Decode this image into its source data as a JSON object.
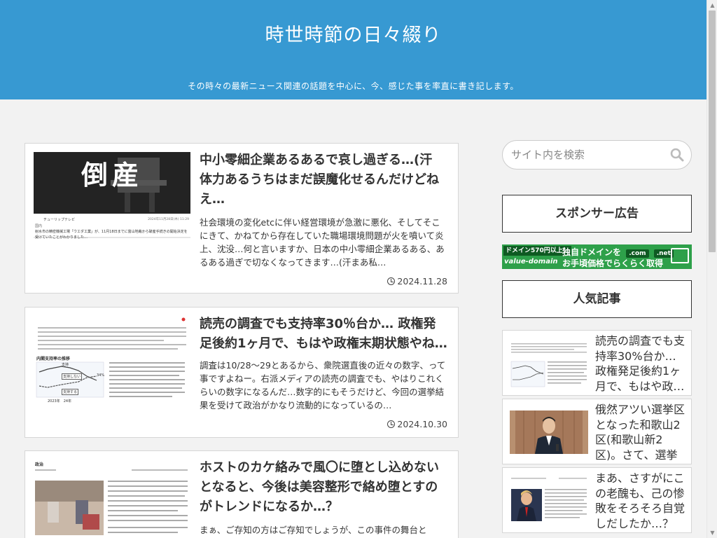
{
  "site": {
    "title": "時世時節の日々綴り",
    "description": "その時々の最新ニュース関連の話題を中心に、今、感じた事を率直に書き記します。"
  },
  "articles": [
    {
      "title": "中小零細企業あるあるで哀し過ぎる…(汗 体力あるうちはまだ誤魔化せるんだけどね え…",
      "excerpt": "社会環境の変化etcに伴い経営環境が急激に悪化、そしてそこにきて、かねてから存在していた職場環境問題が火を噴いて炎上、沈没…何と言いますか、日本の中小零細企業あるある、あるある過ぎで切なくなってきます…(汗まあ私…",
      "date": "2024.11.28",
      "thumb": {
        "headline": "倒産",
        "source": "チューリップテレビ",
        "stamp": "2024年11月28日(木) 11:29",
        "category": "国内",
        "caption": "射水市の精密機械工場「ウエダ工業」が、11月18日までに富山地裁から破産手続きの開始決定を受けていたことがわかりました…"
      }
    },
    {
      "title": "読売の調査でも支持率30％台か… 政権発足後約1ヶ月で、もはや政権末期状態やね…(汗",
      "excerpt": "調査は10/28～29とあるから、衆院選直後の近々の数字、って事ですよねー。右派メディアの読売の調査でも、やはりこれくらいの数字になるんだ…数字的にもそうだけど、今回の選挙結果を受けて政治がかなり流動的になっているの…",
      "date": "2024.10.30",
      "thumb": {
        "heading": "内閣支持率の推移",
        "labels": [
          "支持",
          "支持しない",
          "支持する"
        ],
        "percent": "34%",
        "years": "2023年　24年"
      }
    },
    {
      "title": "ホストのカケ絡みで風〇に堕とし込めないとなると、今後は美容整形で絡め堕とすのがトレンドになるか…？",
      "excerpt": "まぁ、ご存知の方はご存知でしょうが、この事件の舞台と",
      "thumb": {
        "category": "政治"
      }
    }
  ],
  "sidebar": {
    "search_placeholder": "サイト内を検索",
    "sponsor_heading": "スポンサー広告",
    "ad": {
      "tag": "ドメイン570円以上！",
      "brand": "value-domain",
      "line1": "独自ドメインを",
      "tlds": [
        ".com",
        ".net"
      ],
      "line2": "お手頃価格でらくらく取得"
    },
    "popular_heading": "人気記事",
    "popular": [
      {
        "title": "読売の調査でも支持率30%台か… 政権発足後約1ヶ月で、もはや政…"
      },
      {
        "title": "俄然アツい選挙区となった和歌山2区(和歌山新2区)。さて、選挙区民…"
      },
      {
        "title": "まあ、さすがにこの老醜も、己の惨敗をそろそろ自覚しだしたか…？"
      }
    ]
  },
  "colors": {
    "header_bg": "#3799d2",
    "page_bg": "#f2f2f2",
    "ad_green": "#2ea04a"
  },
  "icons": [
    "search-icon",
    "clock-icon",
    "chevron-up-icon",
    "chevron-down-icon"
  ]
}
